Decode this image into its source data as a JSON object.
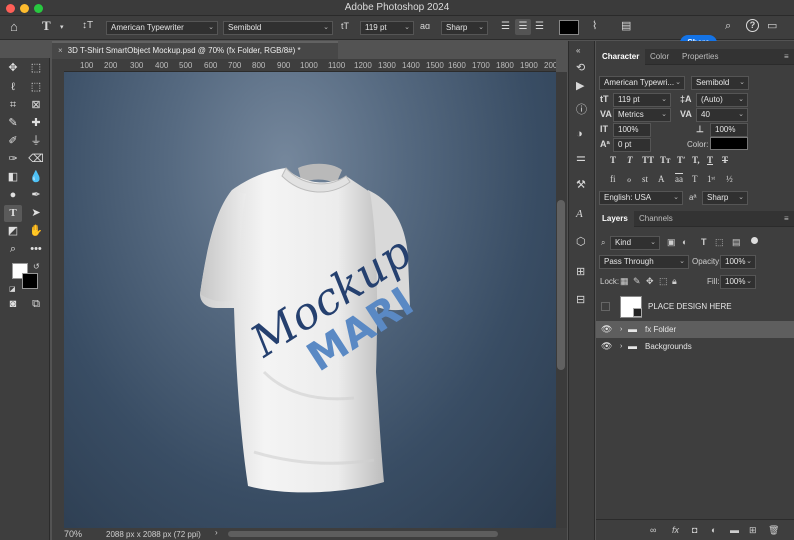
{
  "app": {
    "title": "Adobe Photoshop 2024"
  },
  "options": {
    "font_family": "American Typewriter",
    "font_style": "Semibold",
    "font_size": "119 pt",
    "aa_label": "aɑ",
    "anti_alias": "Sharp",
    "share_label": "Share"
  },
  "document": {
    "tab_title": "3D T-Shirt SmartObject Mockup.psd @ 70% (fx Folder, RGB/8#) *",
    "zoom": "70%",
    "dimensions": "2088 px x 2088 px (72 ppi)",
    "ruler_ticks": [
      "100",
      "200",
      "300",
      "400",
      "500",
      "600",
      "700",
      "800",
      "900",
      "1000",
      "1100",
      "1200",
      "1300",
      "1400",
      "1500",
      "1600",
      "1700",
      "1800",
      "1900",
      "200"
    ]
  },
  "artwork": {
    "line1": "Mockup",
    "line2": "MARI"
  },
  "character_panel": {
    "tabs": [
      "Character",
      "Color",
      "Properties"
    ],
    "font_family": "American Typewri...",
    "font_style": "Semibold",
    "size": "119 pt",
    "leading": "(Auto)",
    "kerning": "Metrics",
    "tracking": "40",
    "vertical_scale": "100%",
    "horizontal_scale": "100%",
    "baseline_shift": "0 pt",
    "color_label": "Color:",
    "language": "English: USA",
    "anti_alias": "Sharp"
  },
  "layers_panel": {
    "tabs": [
      "Layers",
      "Channels"
    ],
    "filter": "Kind",
    "blend_mode": "Pass Through",
    "opacity_label": "Opacity:",
    "opacity": "100%",
    "lock_label": "Lock:",
    "fill_label": "Fill:",
    "fill": "100%",
    "layers": [
      {
        "name": "PLACE DESIGN HERE",
        "type": "smart-object"
      },
      {
        "name": "fx Folder",
        "type": "group",
        "selected": true
      },
      {
        "name": "Backgrounds",
        "type": "group"
      }
    ]
  },
  "colors": {
    "accent": "#1473e6",
    "foreground": "#ffffff",
    "background": "#000000",
    "design_blue": "#3d5f9a"
  }
}
